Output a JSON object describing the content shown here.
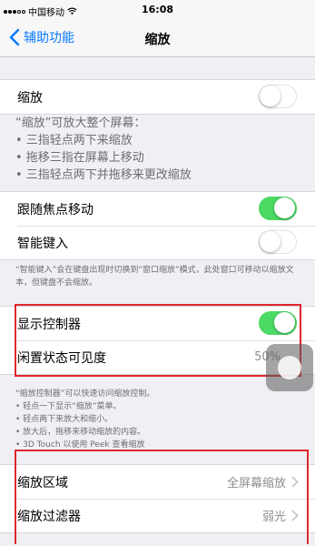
{
  "status_bar": {
    "carrier": "中国移动",
    "time": "16:08"
  },
  "nav": {
    "back_label": "辅助功能",
    "title": "缩放"
  },
  "zoom_row": {
    "label": "缩放",
    "on": false
  },
  "zoom_notes": [
    "“缩放”可放大整个屏幕：",
    "• 三指轻点两下来缩放",
    "• 拖移三指在屏幕上移动",
    "• 三指轻点两下并拖移来更改缩放"
  ],
  "follow_focus": {
    "label": "跟随焦点移动",
    "on": true
  },
  "smart_typing": {
    "label": "智能键入",
    "on": false
  },
  "smart_typing_note": "“智能键入”会在键盘出现时切换到“窗口缩放”模式，此处窗口可移动以缩放文本，但键盘不会缩放。",
  "controller": {
    "show_label": "显示控制器",
    "show_on": true,
    "idle_label": "闲置状态可见度",
    "idle_value": "50%"
  },
  "controller_notes": [
    "“缩放控制器”可以快速访问缩放控制。",
    "• 轻点一下显示“缩放”菜单。",
    "• 轻点两下来放大和缩小。",
    "• 放大后，拖移来移动缩放的内容。",
    "• 3D Touch 以使用 Peek 查看缩放"
  ],
  "zoom_region": {
    "label": "缩放区域",
    "value": "全屏幕缩放"
  },
  "zoom_filter": {
    "label": "缩放过滤器",
    "value": "弱光"
  },
  "colors": {
    "accent": "#0a7aff",
    "toggle_on": "#4cd964",
    "highlight": "#e0262b"
  }
}
